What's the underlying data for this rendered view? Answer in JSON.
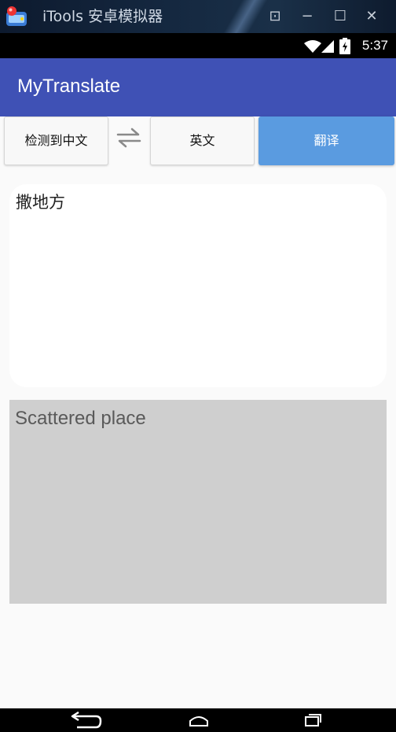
{
  "emulator": {
    "title": "iTools 安卓模拟器",
    "controls": {
      "restore": "⊡",
      "minimize": "−",
      "maximize": "☐",
      "close": "✕"
    }
  },
  "status_bar": {
    "time": "5:37",
    "icons": [
      "wifi-icon",
      "signal-icon",
      "battery-charging-icon"
    ]
  },
  "app_bar": {
    "title": "MyTranslate",
    "color": "#3f51b5"
  },
  "toolbar": {
    "source_language": "检测到中文",
    "swap_icon": "swap-arrows-icon",
    "target_language": "英文",
    "translate_label": "翻译",
    "accent_color": "#5a9be0"
  },
  "input": {
    "text": "撒地方"
  },
  "output": {
    "text": "Scattered place"
  },
  "nav_bar": {
    "icons": [
      "back-icon",
      "home-icon",
      "recents-icon"
    ]
  }
}
